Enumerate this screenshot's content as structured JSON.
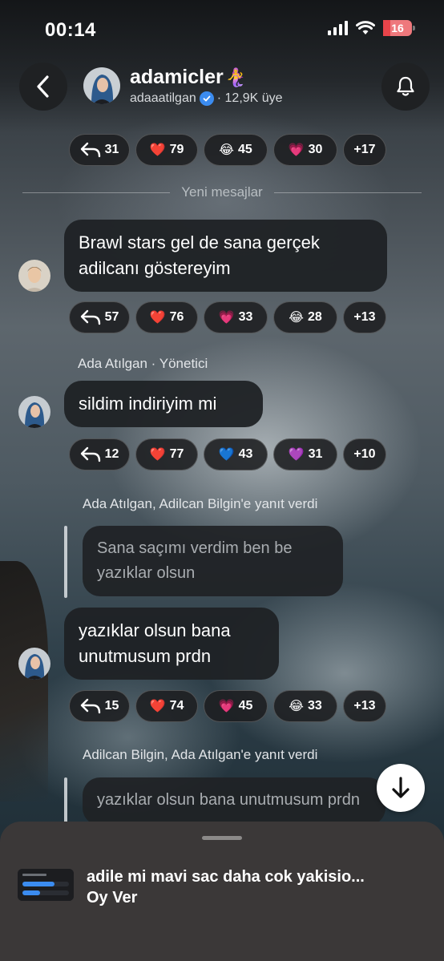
{
  "status_bar": {
    "time": "00:14",
    "battery": "16"
  },
  "header": {
    "channel_name": "adamicler",
    "channel_emoji": "🧜‍♀️",
    "handle": "adaaatilgan",
    "member_count": "· 12,9K üye"
  },
  "top_reactions": {
    "replies": "31",
    "heart": "79",
    "laugh": "45",
    "pink_heart": "30",
    "more": "+17"
  },
  "divider_label": "Yeni mesajlar",
  "messages": [
    {
      "text": "Brawl stars gel de sana gerçek adilcanı göstereyim",
      "reactions": {
        "replies": "57",
        "r1_emoji": "❤️",
        "r1": "76",
        "r2_emoji": "💗",
        "r2": "33",
        "r3_emoji": "😂",
        "r3": "28",
        "more": "+13"
      }
    },
    {
      "sender": "Ada Atılgan · Yönetici",
      "text": "sildim indiriyim mi",
      "reactions": {
        "replies": "12",
        "r1_emoji": "❤️",
        "r1": "77",
        "r2_emoji": "💙",
        "r2": "43",
        "r3_emoji": "💜",
        "r3": "31",
        "more": "+10"
      }
    },
    {
      "reply_header": "Ada Atılgan, Adilcan Bilgin'e yanıt verdi",
      "quote": "Sana saçımı verdim ben be yazıklar olsun",
      "text": "yazıklar olsun bana unutmusum prdn",
      "reactions": {
        "replies": "15",
        "r1_emoji": "❤️",
        "r1": "74",
        "r2_emoji": "💗",
        "r2": "45",
        "r3_emoji": "😂",
        "r3": "33",
        "more": "+13"
      }
    },
    {
      "reply_header": "Adilcan Bilgin, Ada Atılgan'e yanıt verdi",
      "quote": "yazıklar olsun bana unutmusum prdn"
    }
  ],
  "poll": {
    "title": "adile mi mavi sac daha cok yakisio...",
    "cta": "Oy Ver"
  },
  "colors": {
    "bubble": "#1f2225",
    "sheet": "#3b3838",
    "verified": "#3b8cf0",
    "battery": "#e8444a"
  }
}
